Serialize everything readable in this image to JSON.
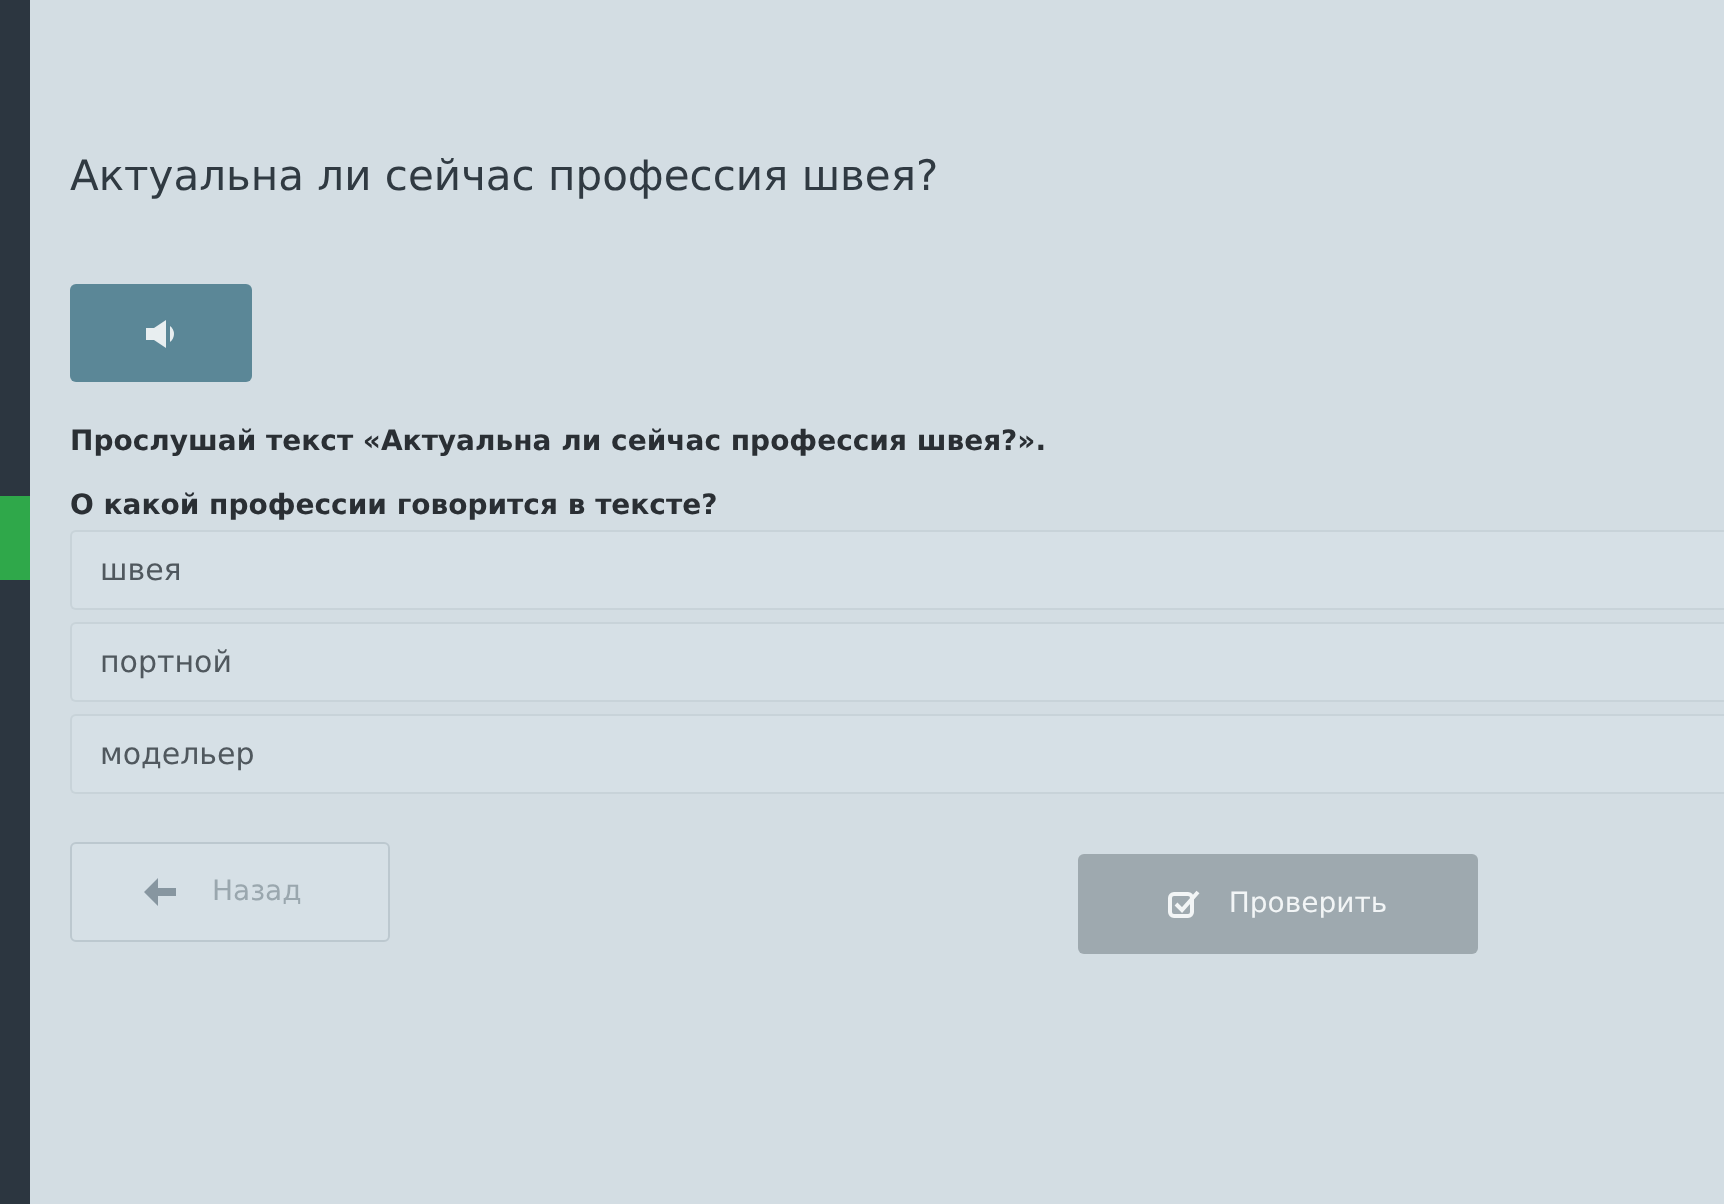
{
  "title": "Актуальна ли сейчас профессия швея?",
  "instructions": [
    "Прослушай текст «Актуальна ли сейчас профессия швея?».",
    "О какой профессии говорится в тексте?"
  ],
  "options": [
    {
      "label": "швея",
      "selected": false
    },
    {
      "label": "портной",
      "selected": false
    },
    {
      "label": "модельер",
      "selected": false
    }
  ],
  "back_button": {
    "label": "Назад"
  },
  "check_button": {
    "label": "Проверить",
    "disabled": true
  }
}
